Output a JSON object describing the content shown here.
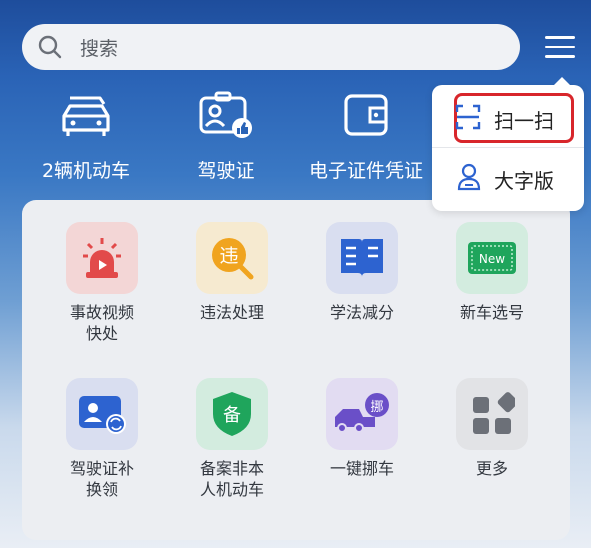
{
  "search": {
    "placeholder": "搜索"
  },
  "shortcuts": [
    {
      "label": "2辆机动车",
      "icon": "car-icon"
    },
    {
      "label": "驾驶证",
      "icon": "driver-license-icon"
    },
    {
      "label": "电子证件凭证",
      "icon": "wallet-icon"
    }
  ],
  "dropdown": {
    "items": [
      {
        "label": "扫一扫",
        "icon": "scan-icon"
      },
      {
        "label": "大字版",
        "icon": "person-icon"
      }
    ]
  },
  "services": [
    {
      "label": "事故视频\n快处",
      "icon": "alarm-light-icon",
      "color": "#f3d6d6"
    },
    {
      "label": "违法处理",
      "icon": "violation-icon",
      "color": "#f6ead0",
      "glyph": "违"
    },
    {
      "label": "学法减分",
      "icon": "book-icon",
      "color": "#d9def0"
    },
    {
      "label": "新车选号",
      "icon": "new-plate-icon",
      "color": "#d3ecdf",
      "glyph": "New"
    },
    {
      "label": "驾驶证补\n换领",
      "icon": "license-renew-icon",
      "color": "#d9def0"
    },
    {
      "label": "备案非本\n人机动车",
      "icon": "shield-record-icon",
      "color": "#d3ecdf",
      "glyph": "备"
    },
    {
      "label": "一键挪车",
      "icon": "move-car-icon",
      "color": "#e2dcf2",
      "glyph": "挪"
    },
    {
      "label": "更多",
      "icon": "more-icon",
      "color": "#e2e3e6"
    }
  ]
}
